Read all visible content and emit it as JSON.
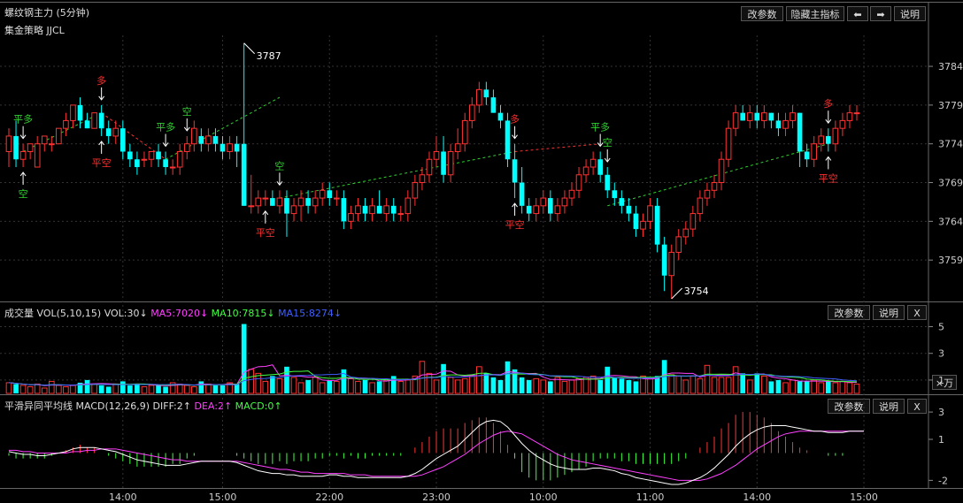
{
  "header": {
    "title": "螺纹钢主力 (5分钟)",
    "strategy": "集金策略 JJCL",
    "buttons": {
      "params": "改参数",
      "hide": "隐藏主指标",
      "prev": "⬅",
      "next": "➡",
      "help": "说明"
    }
  },
  "volume_panel": {
    "name": "成交量",
    "formula": "VOL(5,10,15)",
    "vol": "VOL:30↓",
    "ma5": "MA5:7020↓",
    "ma10": "MA10:7815↓",
    "ma15": "MA15:8274↓",
    "unit": "×万",
    "buttons": {
      "params": "改参数",
      "help": "说明",
      "close": "X"
    }
  },
  "macd_panel": {
    "name": "平滑异同平均线",
    "formula": "MACD(12,26,9)",
    "diff": "DIFF:2↑",
    "dea": "DEA:2↑",
    "macd": "MACD:0↑",
    "buttons": {
      "params": "改参数",
      "help": "说明",
      "close": "X"
    }
  },
  "colors": {
    "up": "#ff3232",
    "down": "#00ffff",
    "bg": "#000000",
    "ma5": "#ff40ff",
    "ma10": "#40ff40",
    "ma15": "#4060ff",
    "diff": "#ffffff",
    "dea": "#ff40ff",
    "signal_long": "#ff3030",
    "signal_short": "#30d030"
  },
  "chart_data": [
    {
      "type": "candlestick",
      "ylim": [
        3754,
        3788
      ],
      "y_ticks": [
        "3784",
        "3779",
        "3774",
        "3769",
        "3764",
        "3759"
      ],
      "x_ticks": [
        "14:00",
        "15:00",
        "22:00",
        "23:00",
        "10:00",
        "11:00",
        "14:00",
        "15:00"
      ],
      "x_tick_bars": [
        16,
        30,
        45,
        60,
        75,
        90,
        105,
        120
      ],
      "high_label": "3787",
      "low_label": "3754",
      "high_bar": 33,
      "low_bar": 93,
      "ohlc": [
        [
          3773,
          3776,
          3771,
          3775
        ],
        [
          3775,
          3777,
          3771,
          3772
        ],
        [
          3772,
          3774,
          3771,
          3773
        ],
        [
          3773,
          3774,
          3772,
          3774
        ],
        [
          3771,
          3775,
          3771,
          3774
        ],
        [
          3774,
          3775,
          3773,
          3775
        ],
        [
          3774,
          3775,
          3773,
          3774
        ],
        [
          3774,
          3776,
          3774,
          3776
        ],
        [
          3776,
          3778,
          3775,
          3777
        ],
        [
          3777,
          3779,
          3776,
          3779
        ],
        [
          3779,
          3780,
          3776,
          3777
        ],
        [
          3777,
          3778,
          3776,
          3776
        ],
        [
          3776,
          3778,
          3776,
          3778
        ],
        [
          3778,
          3779,
          3775,
          3776
        ],
        [
          3776,
          3777,
          3774,
          3775
        ],
        [
          3775,
          3777,
          3774,
          3776
        ],
        [
          3776,
          3777,
          3772,
          3773
        ],
        [
          3773,
          3774,
          3771,
          3772
        ],
        [
          3772,
          3773,
          3770,
          3771
        ],
        [
          3772,
          3773,
          3771,
          3772
        ],
        [
          3772,
          3773,
          3771,
          3773
        ],
        [
          3773,
          3774,
          3771,
          3772
        ],
        [
          3772,
          3773,
          3770,
          3771
        ],
        [
          3771,
          3772,
          3770,
          3771
        ],
        [
          3771,
          3774,
          3770,
          3773
        ],
        [
          3773,
          3775,
          3772,
          3774
        ],
        [
          3774,
          3777,
          3773,
          3776
        ],
        [
          3775,
          3776,
          3773,
          3774
        ],
        [
          3774,
          3776,
          3773,
          3775
        ],
        [
          3775,
          3776,
          3773,
          3774
        ],
        [
          3774,
          3775,
          3772,
          3773
        ],
        [
          3773,
          3775,
          3772,
          3774
        ],
        [
          3774,
          3775,
          3771,
          3773
        ],
        [
          3774,
          3787,
          3766,
          3766
        ],
        [
          3766,
          3770,
          3765,
          3766
        ],
        [
          3766,
          3768,
          3765,
          3767
        ],
        [
          3767,
          3768,
          3766,
          3767
        ],
        [
          3767,
          3768,
          3766,
          3766
        ],
        [
          3766,
          3768,
          3765,
          3767
        ],
        [
          3767,
          3768,
          3762,
          3765
        ],
        [
          3765,
          3767,
          3764,
          3766
        ],
        [
          3766,
          3768,
          3764,
          3767
        ],
        [
          3767,
          3768,
          3765,
          3766
        ],
        [
          3766,
          3768,
          3765,
          3767
        ],
        [
          3767,
          3769,
          3766,
          3768
        ],
        [
          3768,
          3769,
          3766,
          3767
        ],
        [
          3767,
          3768,
          3766,
          3767
        ],
        [
          3767,
          3768,
          3763,
          3764
        ],
        [
          3764,
          3766,
          3763,
          3765
        ],
        [
          3765,
          3767,
          3764,
          3766
        ],
        [
          3766,
          3767,
          3764,
          3765
        ],
        [
          3765,
          3767,
          3764,
          3766
        ],
        [
          3766,
          3768,
          3765,
          3765
        ],
        [
          3765,
          3767,
          3764,
          3766
        ],
        [
          3766,
          3767,
          3764,
          3765
        ],
        [
          3765,
          3766,
          3764,
          3765
        ],
        [
          3765,
          3768,
          3764,
          3767
        ],
        [
          3767,
          3770,
          3766,
          3769
        ],
        [
          3769,
          3771,
          3768,
          3770
        ],
        [
          3770,
          3773,
          3769,
          3772
        ],
        [
          3772,
          3775,
          3771,
          3773
        ],
        [
          3773,
          3775,
          3769,
          3770
        ],
        [
          3770,
          3774,
          3769,
          3773
        ],
        [
          3773,
          3776,
          3772,
          3774
        ],
        [
          3774,
          3778,
          3773,
          3777
        ],
        [
          3777,
          3780,
          3776,
          3779
        ],
        [
          3779,
          3782,
          3778,
          3781
        ],
        [
          3781,
          3782,
          3779,
          3780
        ],
        [
          3780,
          3781,
          3778,
          3778
        ],
        [
          3778,
          3779,
          3776,
          3777
        ],
        [
          3777,
          3778,
          3771,
          3772
        ],
        [
          3772,
          3774,
          3767,
          3769
        ],
        [
          3769,
          3771,
          3765,
          3766
        ],
        [
          3766,
          3767,
          3764,
          3765
        ],
        [
          3765,
          3767,
          3764,
          3766
        ],
        [
          3766,
          3768,
          3765,
          3767
        ],
        [
          3767,
          3768,
          3764,
          3765
        ],
        [
          3765,
          3767,
          3764,
          3766
        ],
        [
          3766,
          3768,
          3765,
          3767
        ],
        [
          3767,
          3769,
          3766,
          3768
        ],
        [
          3768,
          3771,
          3767,
          3770
        ],
        [
          3770,
          3772,
          3769,
          3771
        ],
        [
          3771,
          3773,
          3770,
          3772
        ],
        [
          3772,
          3773,
          3769,
          3770
        ],
        [
          3770,
          3771,
          3767,
          3768
        ],
        [
          3768,
          3769,
          3766,
          3767
        ],
        [
          3767,
          3768,
          3765,
          3766
        ],
        [
          3766,
          3767,
          3764,
          3765
        ],
        [
          3765,
          3766,
          3762,
          3763
        ],
        [
          3763,
          3765,
          3762,
          3764
        ],
        [
          3764,
          3767,
          3763,
          3766
        ],
        [
          3766,
          3767,
          3760,
          3761
        ],
        [
          3761,
          3762,
          3755,
          3757
        ],
        [
          3757,
          3761,
          3754,
          3760
        ],
        [
          3760,
          3763,
          3759,
          3762
        ],
        [
          3762,
          3764,
          3761,
          3763
        ],
        [
          3763,
          3766,
          3762,
          3765
        ],
        [
          3765,
          3768,
          3764,
          3767
        ],
        [
          3767,
          3769,
          3766,
          3768
        ],
        [
          3768,
          3770,
          3767,
          3769
        ],
        [
          3769,
          3773,
          3768,
          3772
        ],
        [
          3772,
          3777,
          3771,
          3776
        ],
        [
          3776,
          3779,
          3775,
          3778
        ],
        [
          3778,
          3779,
          3777,
          3777
        ],
        [
          3777,
          3779,
          3776,
          3778
        ],
        [
          3778,
          3779,
          3776,
          3777
        ],
        [
          3777,
          3779,
          3776,
          3778
        ],
        [
          3778,
          3778,
          3776,
          3777
        ],
        [
          3777,
          3778,
          3775,
          3776
        ],
        [
          3776,
          3778,
          3775,
          3777
        ],
        [
          3777,
          3779,
          3776,
          3778
        ],
        [
          3778,
          3778,
          3771,
          3773
        ],
        [
          3773,
          3774,
          3771,
          3772
        ],
        [
          3772,
          3775,
          3771,
          3774
        ],
        [
          3774,
          3776,
          3773,
          3775
        ],
        [
          3775,
          3776,
          3773,
          3774
        ],
        [
          3774,
          3777,
          3773,
          3776
        ],
        [
          3776,
          3778,
          3775,
          3777
        ],
        [
          3777,
          3779,
          3776,
          3778
        ],
        [
          3778,
          3779,
          3777,
          3778
        ]
      ],
      "signals": [
        {
          "bar": 2,
          "text": "平多",
          "pos": "above"
        },
        {
          "bar": 2,
          "text": "空",
          "pos": "below"
        },
        {
          "bar": 13,
          "text": "多",
          "pos": "above"
        },
        {
          "bar": 13,
          "text": "平空",
          "pos": "below"
        },
        {
          "bar": 22,
          "text": "平多",
          "pos": "above"
        },
        {
          "bar": 25,
          "text": "空",
          "pos": "above"
        },
        {
          "bar": 38,
          "text": "空",
          "pos": "above"
        },
        {
          "bar": 36,
          "text": "平空",
          "pos": "below"
        },
        {
          "bar": 71,
          "text": "多",
          "pos": "above"
        },
        {
          "bar": 71,
          "text": "平空",
          "pos": "below"
        },
        {
          "bar": 83,
          "text": "平多",
          "pos": "above"
        },
        {
          "bar": 84,
          "text": "空",
          "pos": "above"
        },
        {
          "bar": 115,
          "text": "多",
          "pos": "above"
        },
        {
          "bar": 115,
          "text": "平空",
          "pos": "below"
        }
      ],
      "signal_lines": [
        {
          "from": [
            2,
            3773
          ],
          "to": [
            13,
            3778
          ],
          "color": "short"
        },
        {
          "from": [
            13,
            3778
          ],
          "to": [
            22,
            3772
          ],
          "color": "long"
        },
        {
          "from": [
            22,
            3772
          ],
          "to": [
            38,
            3780
          ],
          "color": "short"
        },
        {
          "from": [
            38,
            3767
          ],
          "to": [
            71,
            3773
          ],
          "color": "short"
        },
        {
          "from": [
            71,
            3773
          ],
          "to": [
            83,
            3774
          ],
          "color": "long"
        },
        {
          "from": [
            84,
            3766
          ],
          "to": [
            115,
            3774
          ],
          "color": "short"
        }
      ]
    },
    {
      "type": "bar",
      "name": "volume",
      "y_ticks": [
        "5",
        "3",
        "1"
      ],
      "ylim": [
        0,
        5.5
      ],
      "values": [
        0.8,
        0.7,
        0.6,
        0.5,
        0.7,
        0.4,
        0.9,
        0.6,
        0.5,
        0.6,
        0.8,
        1.0,
        0.7,
        0.6,
        0.5,
        0.7,
        0.9,
        0.6,
        0.7,
        0.5,
        0.6,
        0.6,
        0.5,
        0.8,
        0.7,
        0.6,
        0.5,
        0.9,
        0.7,
        0.6,
        0.6,
        0.8,
        0.7,
        5.2,
        1.8,
        1.5,
        0.9,
        1.3,
        1.1,
        2.0,
        1.2,
        0.8,
        1.0,
        1.2,
        0.8,
        1.0,
        0.9,
        1.8,
        1.1,
        0.9,
        1.0,
        0.8,
        0.9,
        1.0,
        1.3,
        0.9,
        1.0,
        1.3,
        2.4,
        1.5,
        1.0,
        2.2,
        1.2,
        1.0,
        1.1,
        1.3,
        2.0,
        1.5,
        1.2,
        1.0,
        2.4,
        1.8,
        1.2,
        1.0,
        1.1,
        1.0,
        0.9,
        1.2,
        0.9,
        1.0,
        1.1,
        1.2,
        1.3,
        1.0,
        2.0,
        1.2,
        1.1,
        1.0,
        0.9,
        1.3,
        1.1,
        1.3,
        2.5,
        1.4,
        1.3,
        1.0,
        1.3,
        1.1,
        2.1,
        1.2,
        1.2,
        1.2,
        2.0,
        1.5,
        1.0,
        1.5,
        1.3,
        0.9,
        1.0,
        0.8,
        1.0,
        0.9,
        0.9,
        1.0,
        0.8,
        0.9,
        0.8,
        0.9,
        0.8,
        0.7
      ]
    },
    {
      "type": "bar",
      "name": "macd",
      "y_ticks": [
        "3",
        "1",
        "-2"
      ],
      "ylim": [
        -2.3,
        3.2
      ],
      "diff": [
        0.1,
        0.0,
        -0.1,
        -0.1,
        -0.2,
        -0.2,
        -0.1,
        0.0,
        0.1,
        0.3,
        0.4,
        0.4,
        0.4,
        0.3,
        0.2,
        0.1,
        -0.1,
        -0.3,
        -0.5,
        -0.6,
        -0.7,
        -0.8,
        -0.9,
        -0.9,
        -0.9,
        -0.8,
        -0.7,
        -0.6,
        -0.6,
        -0.6,
        -0.6,
        -0.6,
        -0.7,
        -0.9,
        -1.1,
        -1.3,
        -1.4,
        -1.5,
        -1.5,
        -1.6,
        -1.6,
        -1.7,
        -1.7,
        -1.7,
        -1.7,
        -1.6,
        -1.6,
        -1.7,
        -1.7,
        -1.8,
        -1.8,
        -1.8,
        -1.8,
        -1.8,
        -1.8,
        -1.8,
        -1.7,
        -1.5,
        -1.2,
        -0.8,
        -0.4,
        -0.1,
        0.2,
        0.5,
        1.0,
        1.5,
        2.0,
        2.3,
        2.4,
        2.3,
        1.9,
        1.3,
        0.7,
        0.2,
        -0.2,
        -0.5,
        -0.8,
        -1.0,
        -1.1,
        -1.2,
        -1.2,
        -1.2,
        -1.1,
        -1.1,
        -1.2,
        -1.3,
        -1.5,
        -1.6,
        -1.8,
        -1.9,
        -2.0,
        -2.1,
        -2.2,
        -2.3,
        -2.3,
        -2.2,
        -2.0,
        -1.8,
        -1.5,
        -1.1,
        -0.6,
        -0.1,
        0.5,
        1.0,
        1.4,
        1.7,
        1.9,
        2.0,
        2.0,
        2.0,
        1.9,
        1.8,
        1.7,
        1.6,
        1.6,
        1.5,
        1.5,
        1.5,
        1.6,
        1.6,
        1.6
      ],
      "dea": [
        0.2,
        0.2,
        0.1,
        0.1,
        0.0,
        0.0,
        0.0,
        0.0,
        0.0,
        0.1,
        0.1,
        0.2,
        0.2,
        0.3,
        0.3,
        0.3,
        0.2,
        0.1,
        0.0,
        -0.1,
        -0.2,
        -0.3,
        -0.4,
        -0.5,
        -0.5,
        -0.6,
        -0.6,
        -0.6,
        -0.6,
        -0.6,
        -0.6,
        -0.6,
        -0.6,
        -0.7,
        -0.8,
        -0.9,
        -1.0,
        -1.1,
        -1.2,
        -1.2,
        -1.3,
        -1.4,
        -1.4,
        -1.5,
        -1.5,
        -1.5,
        -1.5,
        -1.5,
        -1.6,
        -1.6,
        -1.6,
        -1.7,
        -1.7,
        -1.7,
        -1.7,
        -1.7,
        -1.7,
        -1.7,
        -1.6,
        -1.4,
        -1.2,
        -1.0,
        -0.7,
        -0.4,
        -0.1,
        0.3,
        0.7,
        1.0,
        1.3,
        1.5,
        1.6,
        1.5,
        1.4,
        1.1,
        0.8,
        0.5,
        0.2,
        -0.1,
        -0.3,
        -0.5,
        -0.6,
        -0.7,
        -0.8,
        -0.9,
        -1.0,
        -1.1,
        -1.2,
        -1.3,
        -1.4,
        -1.5,
        -1.6,
        -1.7,
        -1.8,
        -1.9,
        -2.0,
        -2.0,
        -2.0,
        -2.0,
        -1.9,
        -1.7,
        -1.5,
        -1.2,
        -0.9,
        -0.5,
        -0.1,
        0.3,
        0.6,
        0.9,
        1.2,
        1.4,
        1.5,
        1.6,
        1.6,
        1.6,
        1.6,
        1.6,
        1.6,
        1.6,
        1.6,
        1.6,
        1.6
      ]
    }
  ]
}
